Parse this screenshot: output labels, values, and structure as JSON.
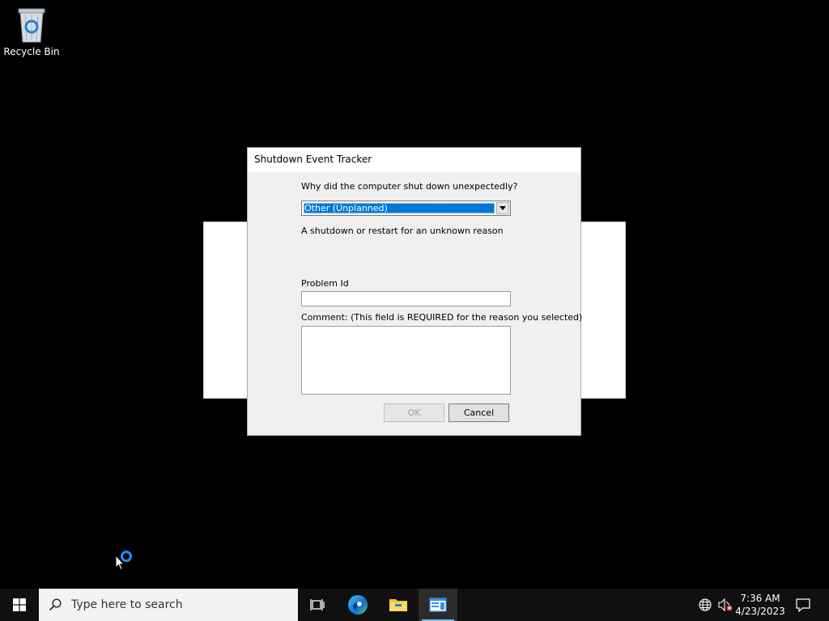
{
  "desktop": {
    "icons": [
      {
        "label": "Recycle Bin",
        "icon": "recycle-bin-icon"
      }
    ]
  },
  "dialog": {
    "title": "Shutdown Event Tracker",
    "question_label": "Why did the computer shut down unexpectedly?",
    "reason_selected": "Other (Unplanned)",
    "reason_description": "A shutdown or restart for an unknown reason",
    "problem_id_label": "Problem Id",
    "problem_id_value": "",
    "comment_label": "Comment: (This field is REQUIRED for the reason you selected)",
    "comment_value": "",
    "ok_label": "OK",
    "cancel_label": "Cancel"
  },
  "taskbar": {
    "search_placeholder": "Type here to search",
    "apps": [
      {
        "name": "task-view",
        "icon": "task-view-icon"
      },
      {
        "name": "edge",
        "icon": "edge-icon"
      },
      {
        "name": "file-explorer",
        "icon": "folder-icon"
      },
      {
        "name": "active-app",
        "icon": "window-app-icon",
        "active": true
      }
    ],
    "tray": {
      "time": "7:36 AM",
      "date": "4/23/2023"
    }
  },
  "colors": {
    "accent": "#0078d7",
    "desktop_bg": "#000000",
    "taskbar_bg": "#101010",
    "dialog_bg": "#f0f0f0"
  }
}
